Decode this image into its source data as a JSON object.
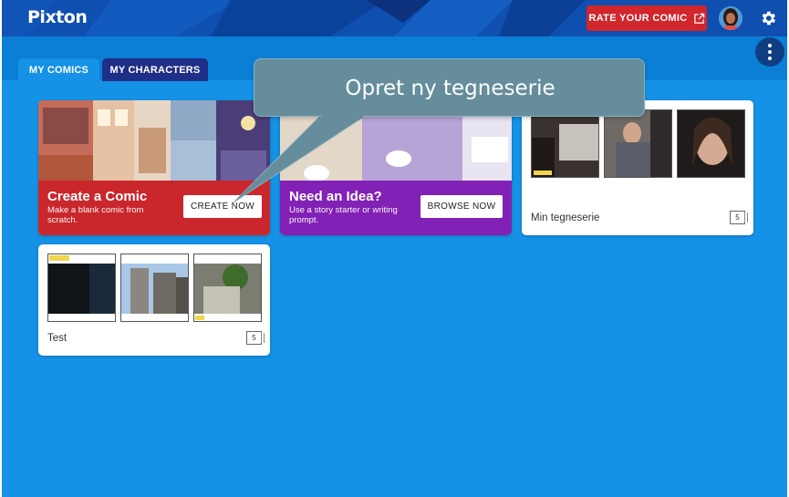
{
  "header": {
    "logo": "Pixton",
    "rate_label": "RATE YOUR COMIC"
  },
  "tabs": [
    {
      "label": "MY COMICS",
      "active": true
    },
    {
      "label": "MY CHARACTERS",
      "active": false
    }
  ],
  "promos": [
    {
      "title": "Create a Comic",
      "subtitle": "Make a blank comic from scratch.",
      "button": "CREATE NOW",
      "color": "#c9272c"
    },
    {
      "title": "Need an Idea?",
      "subtitle": "Use a story starter or writing prompt.",
      "button": "BROWSE NOW",
      "color": "#8221b5"
    }
  ],
  "comics": [
    {
      "title": "Min tegneserie",
      "panels": "5"
    },
    {
      "title": "Test",
      "panels": "5"
    }
  ],
  "tooltip": {
    "text": "Opret ny tegneserie"
  },
  "colors": {
    "header": "#0e4fb0",
    "background": "#1592e6",
    "rate_button": "#d0262c",
    "tab_active": "#1592e6",
    "tab_inactive": "#1f2e86",
    "tooltip": "#658d9c"
  }
}
